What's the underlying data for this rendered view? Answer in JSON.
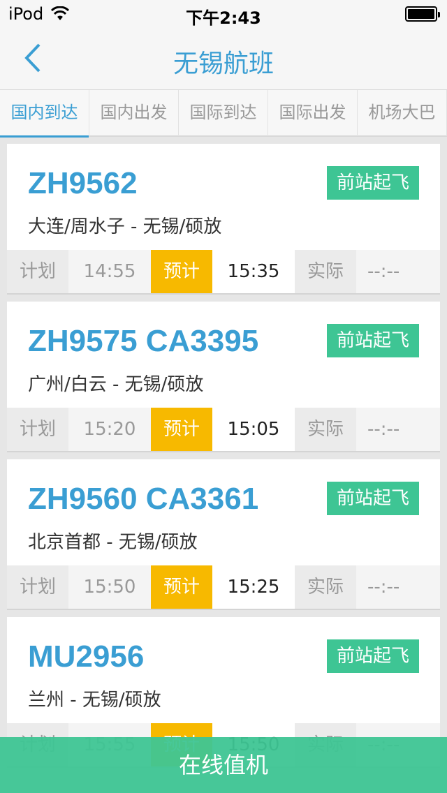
{
  "status_bar": {
    "carrier": "iPod",
    "time": "下午2:43"
  },
  "nav": {
    "title": "无锡航班"
  },
  "tabs": [
    {
      "label": "国内到达",
      "active": true
    },
    {
      "label": "国内出发"
    },
    {
      "label": "国际到达"
    },
    {
      "label": "国际出发"
    },
    {
      "label": "机场大巴"
    }
  ],
  "time_labels": {
    "planned": "计划",
    "estimated": "预计",
    "actual": "实际"
  },
  "flights": [
    {
      "flight_no": "ZH9562",
      "route": "大连/周水子 - 无锡/硕放",
      "status": "前站起飞",
      "planned": "14:55",
      "estimated": "15:35",
      "actual": "--:--"
    },
    {
      "flight_no": "ZH9575 CA3395",
      "route": "广州/白云 - 无锡/硕放",
      "status": "前站起飞",
      "planned": "15:20",
      "estimated": "15:05",
      "actual": "--:--"
    },
    {
      "flight_no": "ZH9560 CA3361",
      "route": "北京首都 - 无锡/硕放",
      "status": "前站起飞",
      "planned": "15:50",
      "estimated": "15:25",
      "actual": "--:--"
    },
    {
      "flight_no": "MU2956",
      "route": "兰州 - 无锡/硕放",
      "status": "前站起飞",
      "planned": "15:55",
      "estimated": "15:50",
      "actual": "--:--"
    }
  ],
  "checkin": {
    "label": "在线值机"
  },
  "colors": {
    "accent": "#3a9ed3",
    "status_green": "#3ec594",
    "estimated_yellow": "#f7b900"
  }
}
